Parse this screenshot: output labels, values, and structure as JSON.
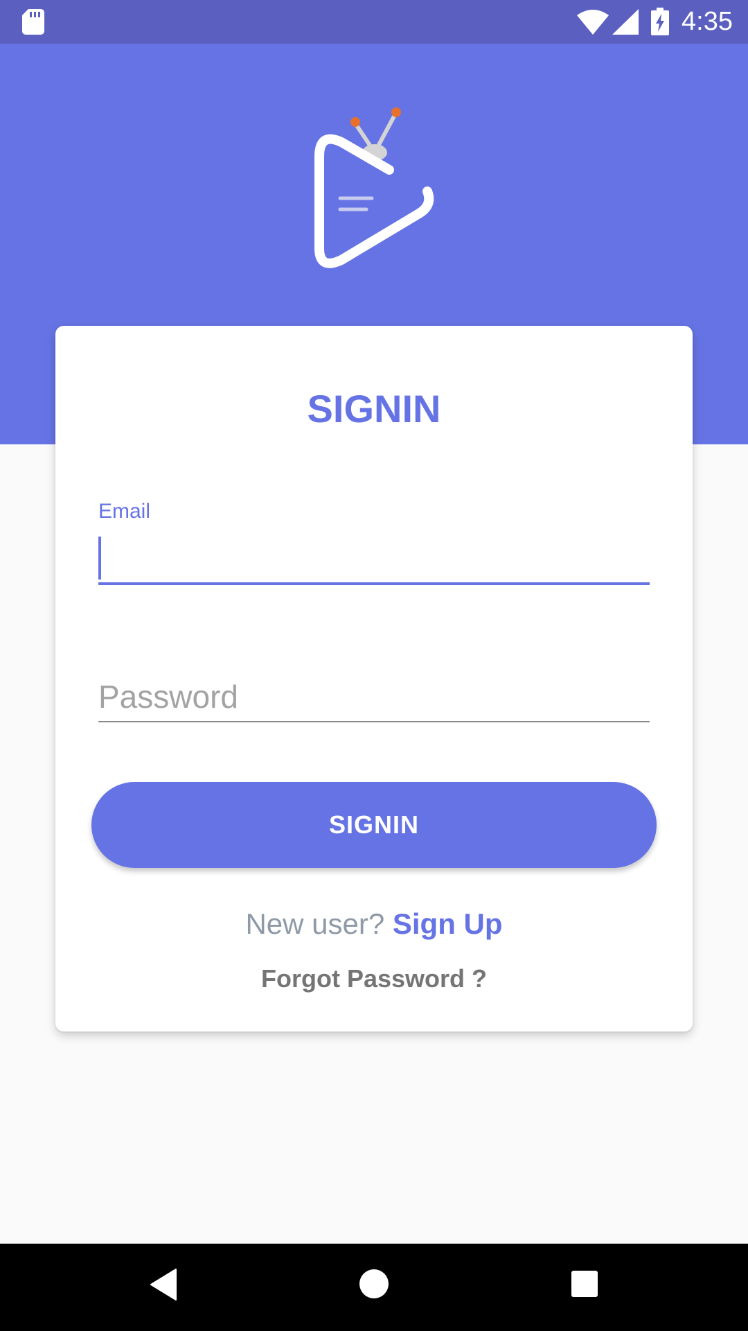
{
  "status_bar": {
    "time": "4:35",
    "icons": [
      "sd-card-icon",
      "wifi-icon",
      "cell-signal-icon",
      "battery-charging-icon"
    ]
  },
  "logo": {
    "icon": "tv-play-logo-icon"
  },
  "card": {
    "title": "SIGNIN"
  },
  "form": {
    "email_label": "Email",
    "email_value": "",
    "password_placeholder": "Password",
    "password_value": "",
    "signin_label": "SIGNIN"
  },
  "links": {
    "new_user_text": "New user? ",
    "signup_label": "Sign Up",
    "forgot_password": "Forgot Password ?"
  },
  "navigation": {
    "icons": [
      "back-icon",
      "home-icon",
      "recents-icon"
    ]
  },
  "colors": {
    "primary": "#6673e4",
    "status_bar": "#5b60c0",
    "background": "#fafafa",
    "muted_text": "#8f9aa6",
    "secondary_text": "#757575",
    "logo_accent": "#e8702a"
  }
}
